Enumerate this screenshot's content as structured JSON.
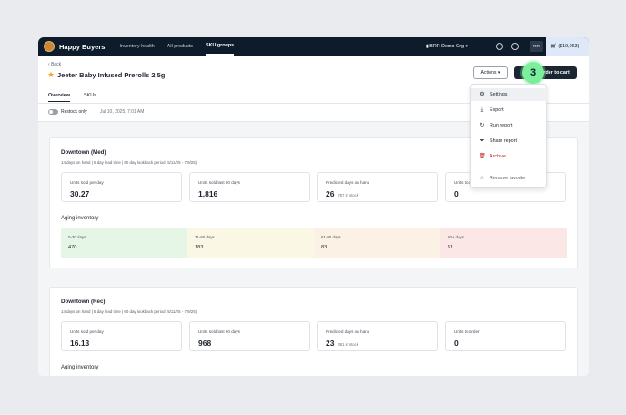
{
  "app": {
    "name": "Happy Buyers",
    "nav": [
      "Inventory health",
      "All products",
      "SKU groups"
    ],
    "active_nav": "SKU groups",
    "org": "BRR Demo Org",
    "avatar_initials": "RR",
    "cart": "($19,063)",
    "icons": [
      "gear-icon",
      "help-icon",
      "cart-icon",
      "chevron-down-icon"
    ]
  },
  "header": {
    "back": "Back",
    "title": "Jeeter Baby Infused Prerolls 2.5g",
    "actions_label": "Actions",
    "order_label": "order to cart",
    "step_number": "3"
  },
  "tabs": [
    "Overview",
    "SKUs"
  ],
  "toolbar": {
    "restock_label": "Restock only",
    "timestamp": "Jul 10, 2025, 7:01 AM"
  },
  "actions_menu": [
    {
      "label": "Settings",
      "icon": "gear-icon"
    },
    {
      "label": "Export",
      "icon": "download-icon"
    },
    {
      "label": "Run report",
      "icon": "refresh-icon"
    },
    {
      "label": "Share report",
      "icon": "filter-icon"
    },
    {
      "label": "Archive",
      "icon": "trash-icon"
    },
    {
      "label": "Remove favorite",
      "icon": "star-icon"
    }
  ],
  "locations": [
    {
      "name": "Downtown (Med)",
      "meta": "14 days on hand   |   5 day lead time   |   60 day lookback period   (5/11/25 - 7/9/25)",
      "metrics": [
        {
          "label": "Units sold per day",
          "value": "30.27",
          "sub": ""
        },
        {
          "label": "Units sold last 60 days",
          "value": "1,816",
          "sub": ""
        },
        {
          "label": "Predicted days on hand",
          "value": "26",
          "sub": "787 in stock"
        },
        {
          "label": "Units to order",
          "value": "0",
          "sub": ""
        }
      ],
      "aging_title": "Aging inventory",
      "aging": [
        {
          "label": "0-30 days",
          "value": "470"
        },
        {
          "label": "31-60 days",
          "value": "183"
        },
        {
          "label": "61-90 days",
          "value": "83"
        },
        {
          "label": "90+ days",
          "value": "51"
        }
      ]
    },
    {
      "name": "Downtown (Rec)",
      "meta": "14 days on hand   |   5 day lead time   |   60 day lookback period   (5/11/25 - 7/9/25)",
      "metrics": [
        {
          "label": "Units sold per day",
          "value": "16.13",
          "sub": ""
        },
        {
          "label": "Units sold last 60 days",
          "value": "968",
          "sub": ""
        },
        {
          "label": "Predicted days on hand",
          "value": "23",
          "sub": "381 in stock"
        },
        {
          "label": "Units to order",
          "value": "0",
          "sub": ""
        }
      ],
      "aging_title": "Aging inventory",
      "aging": []
    }
  ],
  "colors": {
    "nav_bg": "#0d1b2a",
    "aging_0_30": "#e6f6e6",
    "aging_31_60": "#fbf7e5",
    "aging_61_90": "#fbf1e5",
    "aging_90_plus": "#fbe8e6",
    "step_badge": "#7cef9c",
    "danger": "#c62828",
    "favorite": "#f2a81c"
  }
}
